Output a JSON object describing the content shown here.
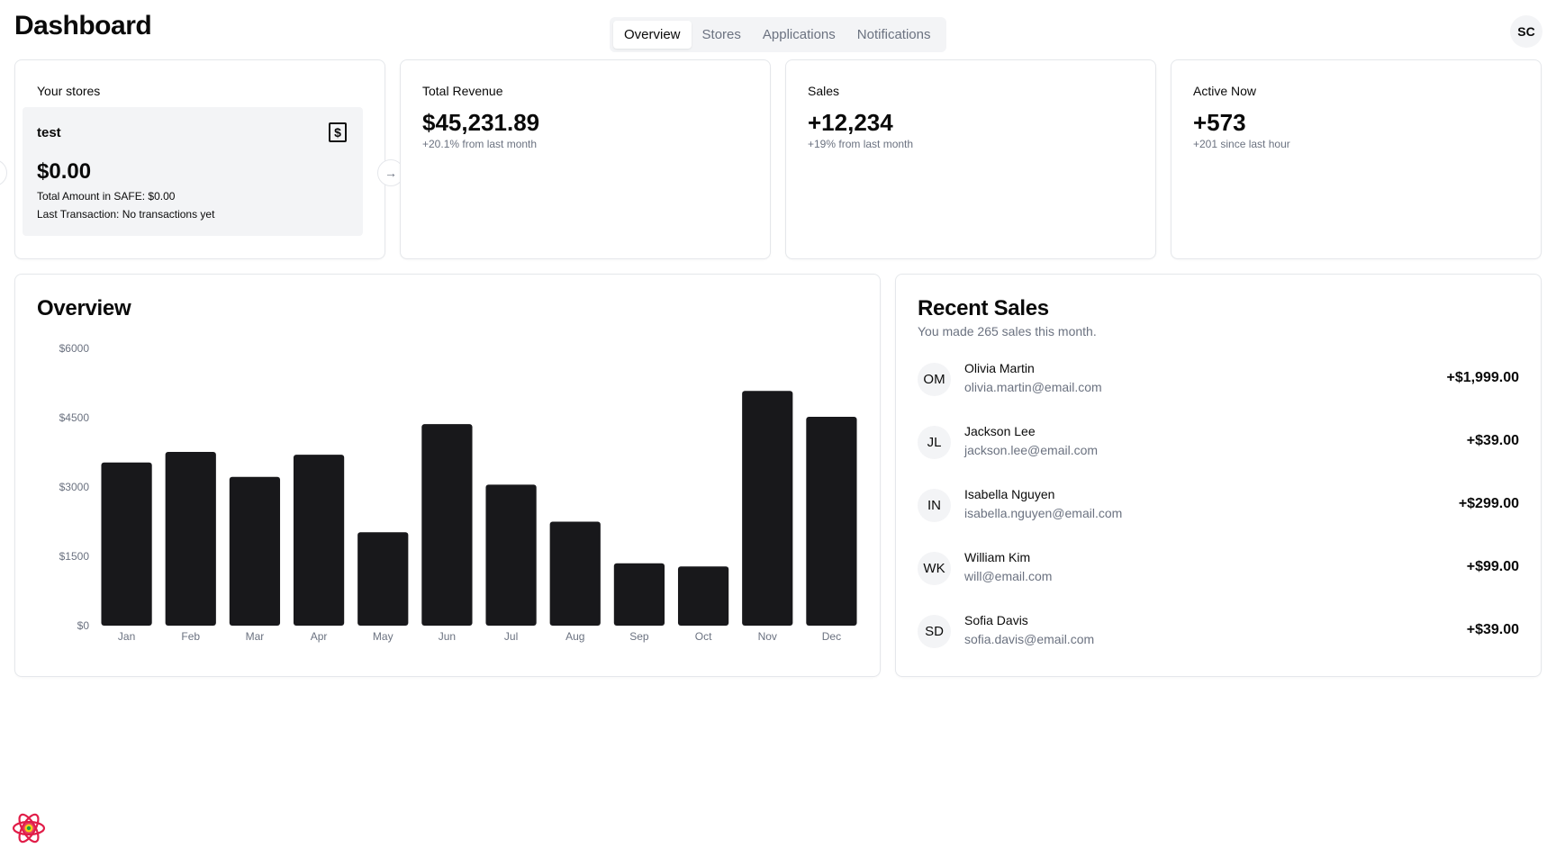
{
  "header": {
    "title": "Dashboard",
    "tabs": [
      {
        "label": "Overview",
        "active": true
      },
      {
        "label": "Stores",
        "active": false
      },
      {
        "label": "Applications",
        "active": false
      },
      {
        "label": "Notifications",
        "active": false
      }
    ],
    "user_initials": "SC"
  },
  "stores_card": {
    "title": "Your stores",
    "store": {
      "name": "test",
      "amount": "$0.00",
      "safe_line": "Total Amount in SAFE: $0.00",
      "last_transaction_line": "Last Transaction: No transactions yet",
      "icon": "receipt-dollar-icon"
    },
    "next_icon": "arrow-right-icon"
  },
  "stats": [
    {
      "title": "Total Revenue",
      "value": "$45,231.89",
      "sub": "+20.1% from last month"
    },
    {
      "title": "Sales",
      "value": "+12,234",
      "sub": "+19% from last month"
    },
    {
      "title": "Active Now",
      "value": "+573",
      "sub": "+201 since last hour"
    }
  ],
  "overview": {
    "title": "Overview"
  },
  "chart_data": {
    "type": "bar",
    "title": "Overview",
    "categories": [
      "Jan",
      "Feb",
      "Mar",
      "Apr",
      "May",
      "Jun",
      "Jul",
      "Aug",
      "Sep",
      "Oct",
      "Nov",
      "Dec"
    ],
    "values": [
      3530,
      3760,
      3220,
      3700,
      2020,
      4360,
      3050,
      2250,
      1350,
      1280,
      5080,
      4520
    ],
    "y_ticks": [
      "$6000",
      "$4500",
      "$3000",
      "$1500",
      "$0"
    ],
    "ylim": [
      0,
      6000
    ],
    "bar_color": "#18181b",
    "grid": false
  },
  "recent_sales": {
    "title": "Recent Sales",
    "subtitle": "You made 265 sales this month.",
    "items": [
      {
        "initials": "OM",
        "name": "Olivia Martin",
        "email": "olivia.martin@email.com",
        "amount": "+$1,999.00"
      },
      {
        "initials": "JL",
        "name": "Jackson Lee",
        "email": "jackson.lee@email.com",
        "amount": "+$39.00"
      },
      {
        "initials": "IN",
        "name": "Isabella Nguyen",
        "email": "isabella.nguyen@email.com",
        "amount": "+$299.00"
      },
      {
        "initials": "WK",
        "name": "William Kim",
        "email": "will@email.com",
        "amount": "+$99.00"
      },
      {
        "initials": "SD",
        "name": "Sofia Davis",
        "email": "sofia.davis@email.com",
        "amount": "+$39.00"
      }
    ]
  },
  "footer": {
    "logo_icon": "react-logo-icon"
  }
}
